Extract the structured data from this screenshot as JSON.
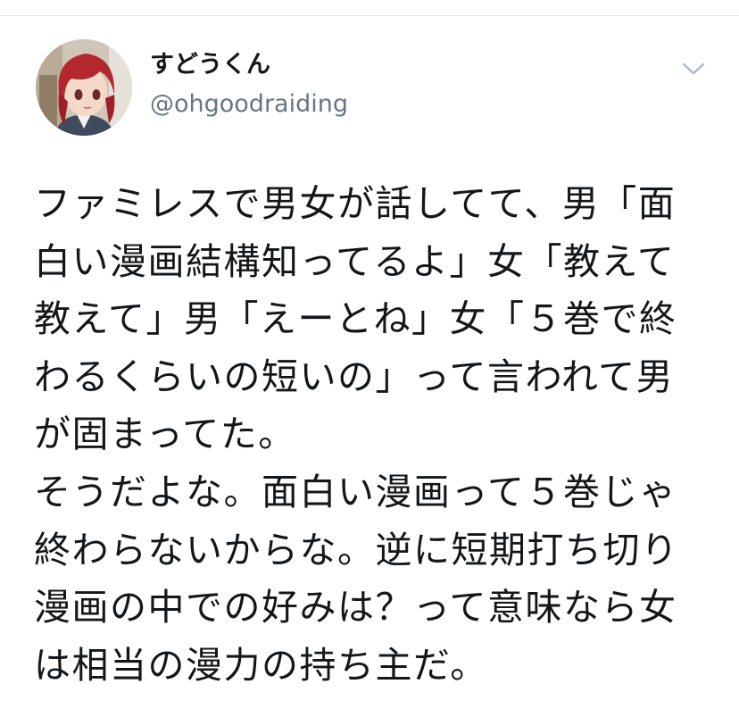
{
  "tweet": {
    "author": {
      "display_name": "すどうくん",
      "handle": "@ohgoodraiding",
      "avatar_icon": "avatar-anime-character"
    },
    "menu_icon": "chevron-down-icon",
    "text": "ファミレスで男女が話してて、男「面白い漫画結構知ってるよ」女「教えて教えて」男「えーとね」女「５巻で終わるくらいの短いの」って言われて男が固まってた。\nそうだよな。面白い漫画って５巻じゃ終わらないからな。逆に短期打ち切り漫画の中での好みは？って意味なら女は相当の漫力の持ち主だ。"
  },
  "colors": {
    "text_primary": "#14171a",
    "text_secondary": "#657786",
    "divider": "#e1e8ed",
    "caret": "#aab8c2"
  }
}
